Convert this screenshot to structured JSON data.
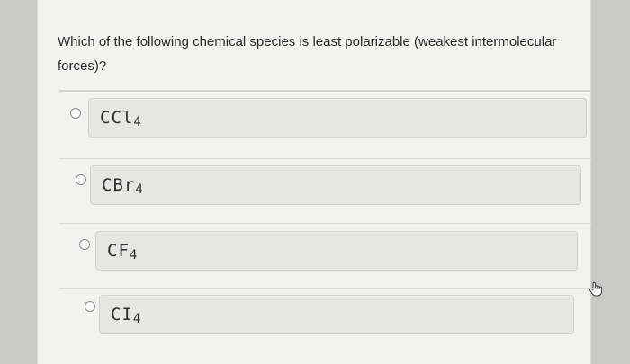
{
  "question": {
    "text": "Which of the following chemical species is least polarizable (weakest intermolecular forces)?"
  },
  "options": [
    {
      "label": "CCl4",
      "selected": false
    },
    {
      "label": "CBr4",
      "selected": false
    },
    {
      "label": "CF4",
      "selected": false
    },
    {
      "label": "CI4",
      "selected": false
    }
  ],
  "cursor": {
    "icon": "hand-pointer-icon"
  }
}
